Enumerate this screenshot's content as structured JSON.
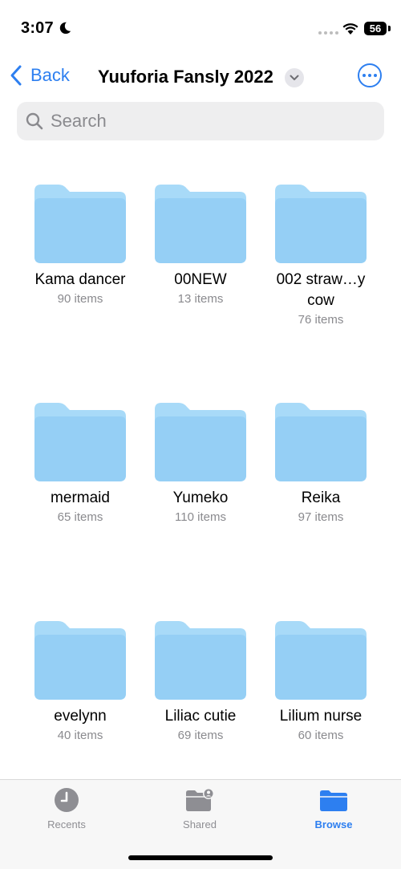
{
  "status_bar": {
    "time": "3:07",
    "battery": "56"
  },
  "nav": {
    "back_label": "Back",
    "title": "Yuuforia Fansly 2022"
  },
  "search": {
    "placeholder": "Search"
  },
  "folders": [
    {
      "name": "Kama dancer",
      "count": "90 items"
    },
    {
      "name": "00NEW",
      "count": "13 items"
    },
    {
      "name": "002 straw…y cow",
      "count": "76 items"
    },
    {
      "name": "mermaid",
      "count": "65 items"
    },
    {
      "name": "Yumeko",
      "count": "110 items"
    },
    {
      "name": "Reika",
      "count": "97 items"
    },
    {
      "name": "evelynn",
      "count": "40 items"
    },
    {
      "name": "Liliac cutie",
      "count": "69 items"
    },
    {
      "name": "Lilium nurse",
      "count": "60 items"
    }
  ],
  "tabs": [
    {
      "label": "Recents",
      "icon": "clock-icon"
    },
    {
      "label": "Shared",
      "icon": "shared-folder-icon"
    },
    {
      "label": "Browse",
      "icon": "folder-icon"
    }
  ],
  "colors": {
    "accent": "#2d7ff0",
    "folder": "#9fd6f7",
    "folder_dark": "#8ecdf4"
  }
}
